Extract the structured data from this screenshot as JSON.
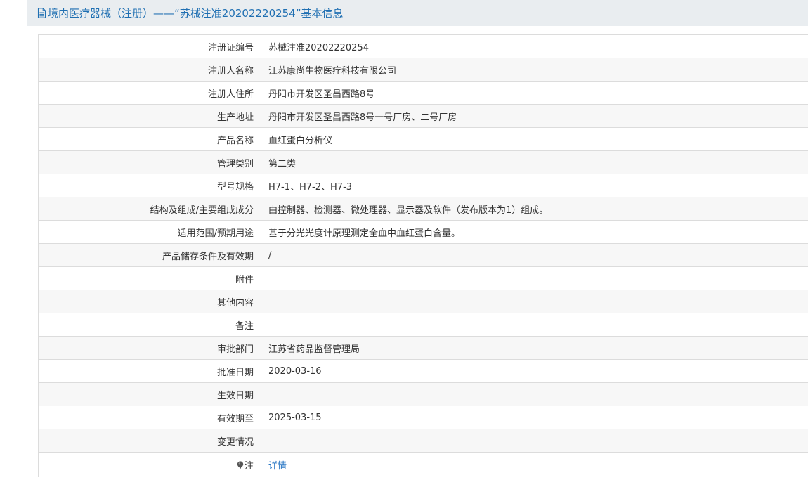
{
  "header": {
    "title": "境内医疗器械（注册）——“苏械注准20202220254”基本信息",
    "icon": "document-icon"
  },
  "rows": [
    {
      "label": "注册证编号",
      "value": "苏械注准20202220254"
    },
    {
      "label": "注册人名称",
      "value": "江苏康尚生物医疗科技有限公司"
    },
    {
      "label": "注册人住所",
      "value": "丹阳市开发区圣昌西路8号"
    },
    {
      "label": "生产地址",
      "value": "丹阳市开发区圣昌西路8号一号厂房、二号厂房"
    },
    {
      "label": "产品名称",
      "value": "血红蛋白分析仪"
    },
    {
      "label": "管理类别",
      "value": "第二类"
    },
    {
      "label": "型号规格",
      "value": "H7-1、H7-2、H7-3"
    },
    {
      "label": "结构及组成/主要组成成分",
      "value": "由控制器、检测器、微处理器、显示器及软件（发布版本为1）组成。"
    },
    {
      "label": "适用范围/预期用途",
      "value": "基于分光光度计原理测定全血中血红蛋白含量。"
    },
    {
      "label": "产品储存条件及有效期",
      "value": "/"
    },
    {
      "label": "附件",
      "value": ""
    },
    {
      "label": "其他内容",
      "value": ""
    },
    {
      "label": "备注",
      "value": ""
    },
    {
      "label": "审批部门",
      "value": "江苏省药品监督管理局"
    },
    {
      "label": "批准日期",
      "value": "2020-03-16"
    },
    {
      "label": "生效日期",
      "value": ""
    },
    {
      "label": "有效期至",
      "value": "2025-03-15"
    },
    {
      "label": "变更情况",
      "value": ""
    }
  ],
  "note": {
    "label": "注",
    "icon": "pin-icon",
    "link_text": "详情"
  },
  "colors": {
    "header_bg": "#e9edf0",
    "title": "#1f6fb2",
    "link": "#2b78c5",
    "border": "#dcdcdc"
  }
}
